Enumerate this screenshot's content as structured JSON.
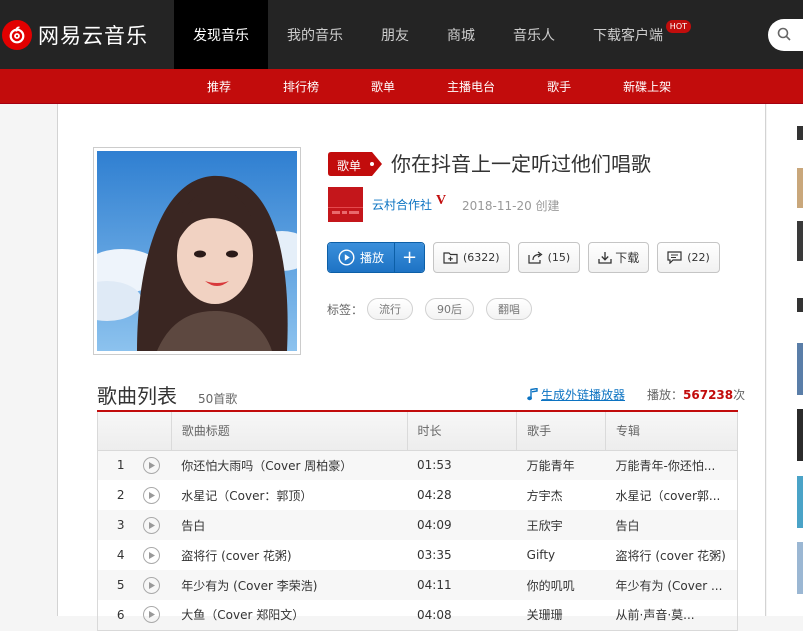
{
  "brand": {
    "name": "网易云音乐",
    "accent": "#c20c0c"
  },
  "nav": {
    "items": [
      {
        "label": "发现音乐",
        "active": true
      },
      {
        "label": "我的音乐"
      },
      {
        "label": "朋友"
      },
      {
        "label": "商城"
      },
      {
        "label": "音乐人"
      },
      {
        "label": "下载客户端",
        "badge": "HOT"
      }
    ]
  },
  "subnav": {
    "items": [
      "推荐",
      "排行榜",
      "歌单",
      "主播电台",
      "歌手",
      "新碟上架"
    ]
  },
  "playlist": {
    "type_badge": "歌单",
    "title": "你在抖音上一定听过他们唱歌",
    "creator": "云村合作社",
    "creator_mark": "V",
    "created": "2018-11-20 创建",
    "buttons": {
      "play": "播放",
      "add": "+",
      "collect": "(6322)",
      "share": "(15)",
      "download": "下载",
      "comment": "(22)"
    },
    "tags_label": "标签：",
    "tags": [
      "流行",
      "90后",
      "翻唱"
    ]
  },
  "songlist": {
    "title": "歌曲列表",
    "count": "50首歌",
    "ext_link": "生成外链播放器",
    "play_label": "播放：",
    "play_count": "567238",
    "play_suffix": "次",
    "columns": [
      "",
      "",
      "歌曲标题",
      "时长",
      "歌手",
      "专辑"
    ],
    "rows": [
      {
        "index": "1",
        "title": "你还怕大雨吗（Cover 周柏豪）",
        "duration": "01:53",
        "artist": "万能青年",
        "album": "万能青年-你还怕..."
      },
      {
        "index": "2",
        "title": "水星记（Cover：郭顶）",
        "duration": "04:28",
        "artist": "方宇杰",
        "album": "水星记（cover郭..."
      },
      {
        "index": "3",
        "title": "告白",
        "duration": "04:09",
        "artist": "王欣宇",
        "album": "告白"
      },
      {
        "index": "4",
        "title": "盗将行 (cover 花粥)",
        "duration": "03:35",
        "artist": "Gifty",
        "album": "盗将行 (cover 花粥)"
      },
      {
        "index": "5",
        "title": "年少有为 (Cover 李荣浩)",
        "duration": "04:11",
        "artist": "你的叽叽",
        "album": "年少有为 (Cover ..."
      },
      {
        "index": "6",
        "title": "大鱼（Cover 郑阳文）",
        "duration": "04:08",
        "artist": "关珊珊",
        "album": "从前·声音·莫..."
      }
    ]
  }
}
